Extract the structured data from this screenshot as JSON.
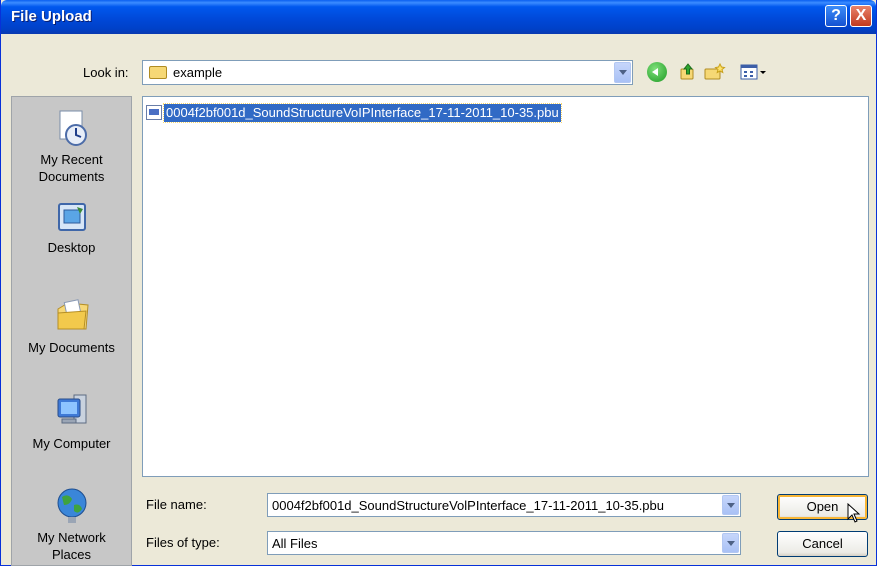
{
  "window": {
    "title": "File Upload"
  },
  "titlebar_buttons": {
    "help": "?",
    "close": "X"
  },
  "lookin": {
    "label": "Look in:",
    "value": "example"
  },
  "toolbar": {
    "icons": [
      "back-icon",
      "up-folder-icon",
      "new-folder-icon",
      "views-menu-icon"
    ]
  },
  "places": [
    {
      "name": "My Recent Documents",
      "line1": "My Recent",
      "line2": "Documents",
      "icon": "recent-documents-icon"
    },
    {
      "name": "Desktop",
      "line1": "Desktop",
      "line2": "",
      "icon": "desktop-icon"
    },
    {
      "name": "My Documents",
      "line1": "My Documents",
      "line2": "",
      "icon": "my-documents-icon"
    },
    {
      "name": "My Computer",
      "line1": "My Computer",
      "line2": "",
      "icon": "my-computer-icon"
    },
    {
      "name": "My Network Places",
      "line1": "My Network",
      "line2": "Places",
      "icon": "network-places-icon"
    }
  ],
  "files": [
    {
      "name": "0004f2bf001d_SoundStructureVoIPInterface_17-11-2011_10-35.pbu",
      "selected": true
    }
  ],
  "file_name": {
    "label": "File name:",
    "value": "0004f2bf001d_SoundStructureVolPInterface_17-11-2011_10-35.pbu"
  },
  "file_type": {
    "label": "Files of type:",
    "value": "All Files"
  },
  "buttons": {
    "open": "Open",
    "cancel": "Cancel"
  },
  "colors": {
    "titlebar": "#0054E3",
    "selection": "#316AC5",
    "dialog_bg": "#ECE9D8",
    "places_bg": "#C7C7C7"
  }
}
